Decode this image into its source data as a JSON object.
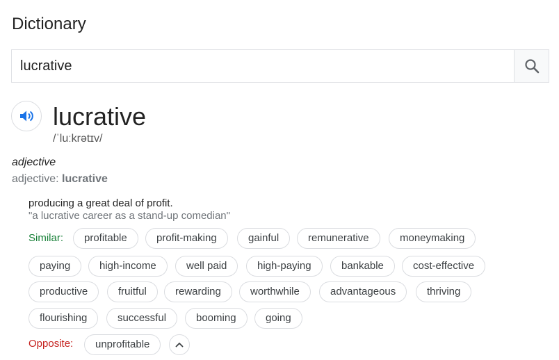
{
  "header": {
    "title": "Dictionary"
  },
  "search": {
    "value": "lucrative"
  },
  "entry": {
    "word": "lucrative",
    "phonetic": "/ˈluːkrətɪv/",
    "part_of_speech": "adjective",
    "forms_prefix": "adjective: ",
    "forms_word": "lucrative",
    "definition": "producing a great deal of profit.",
    "example": "\"a lucrative career as a stand-up comedian\""
  },
  "similar": {
    "label": "Similar:",
    "words": [
      "profitable",
      "profit-making",
      "gainful",
      "remunerative",
      "moneymaking",
      "paying",
      "high-income",
      "well paid",
      "high-paying",
      "bankable",
      "cost-effective",
      "productive",
      "fruitful",
      "rewarding",
      "worthwhile",
      "advantageous",
      "thriving",
      "flourishing",
      "successful",
      "booming",
      "going"
    ]
  },
  "opposite": {
    "label": "Opposite:",
    "words": [
      "unprofitable"
    ]
  },
  "icons": {
    "search": "search-icon",
    "speaker": "speaker-icon",
    "collapse": "chevron-up-icon"
  },
  "colors": {
    "accent": "#1a73e8",
    "similar_label": "#188038",
    "opposite_label": "#c5221f"
  }
}
